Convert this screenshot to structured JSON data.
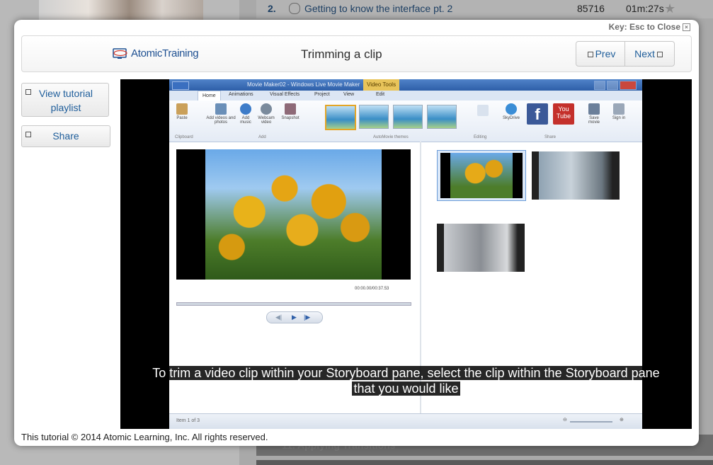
{
  "background": {
    "list_row": {
      "number": "2.",
      "title": "Getting to know the interface pt. 2",
      "views": "85716",
      "duration": "01m:27s"
    },
    "bottom_row_text": "11. Applying Transitions"
  },
  "modal": {
    "key_close": "Key: Esc to Close",
    "logo_text": "AtomicTraining",
    "title": "Trimming a clip",
    "prev_label": "Prev",
    "next_label": "Next",
    "playlist_label": "View tutorial playlist",
    "share_label": "Share",
    "copyright": "This tutorial © 2014 Atomic Learning, Inc.   All rights reserved."
  },
  "video": {
    "app_title": "Movie Maker02 - Windows Live Movie Maker",
    "context_tab": "Video Tools",
    "tabs": [
      "Home",
      "Animations",
      "Visual Effects",
      "Project",
      "View",
      "Edit"
    ],
    "ribbon": {
      "paste": "Paste",
      "add_videos": "Add videos and photos",
      "add_music": "Add music",
      "webcam": "Webcam video",
      "snapshot": "Snapshot",
      "skydrive": "SkyDrive",
      "youtube": "You Tube",
      "save_movie": "Save movie",
      "sign_in": "Sign in",
      "groups": {
        "clipboard": "Clipboard",
        "add": "Add",
        "themes": "AutoMovie themes",
        "editing": "Editing",
        "share": "Share"
      }
    },
    "time_readout": "00:00.00/00:37.53",
    "status_item": "Item 1 of 3",
    "subtitle_line1": "To trim a video clip within your Storyboard pane, select the clip within the Storyboard pane",
    "subtitle_line2": "that you would like"
  }
}
